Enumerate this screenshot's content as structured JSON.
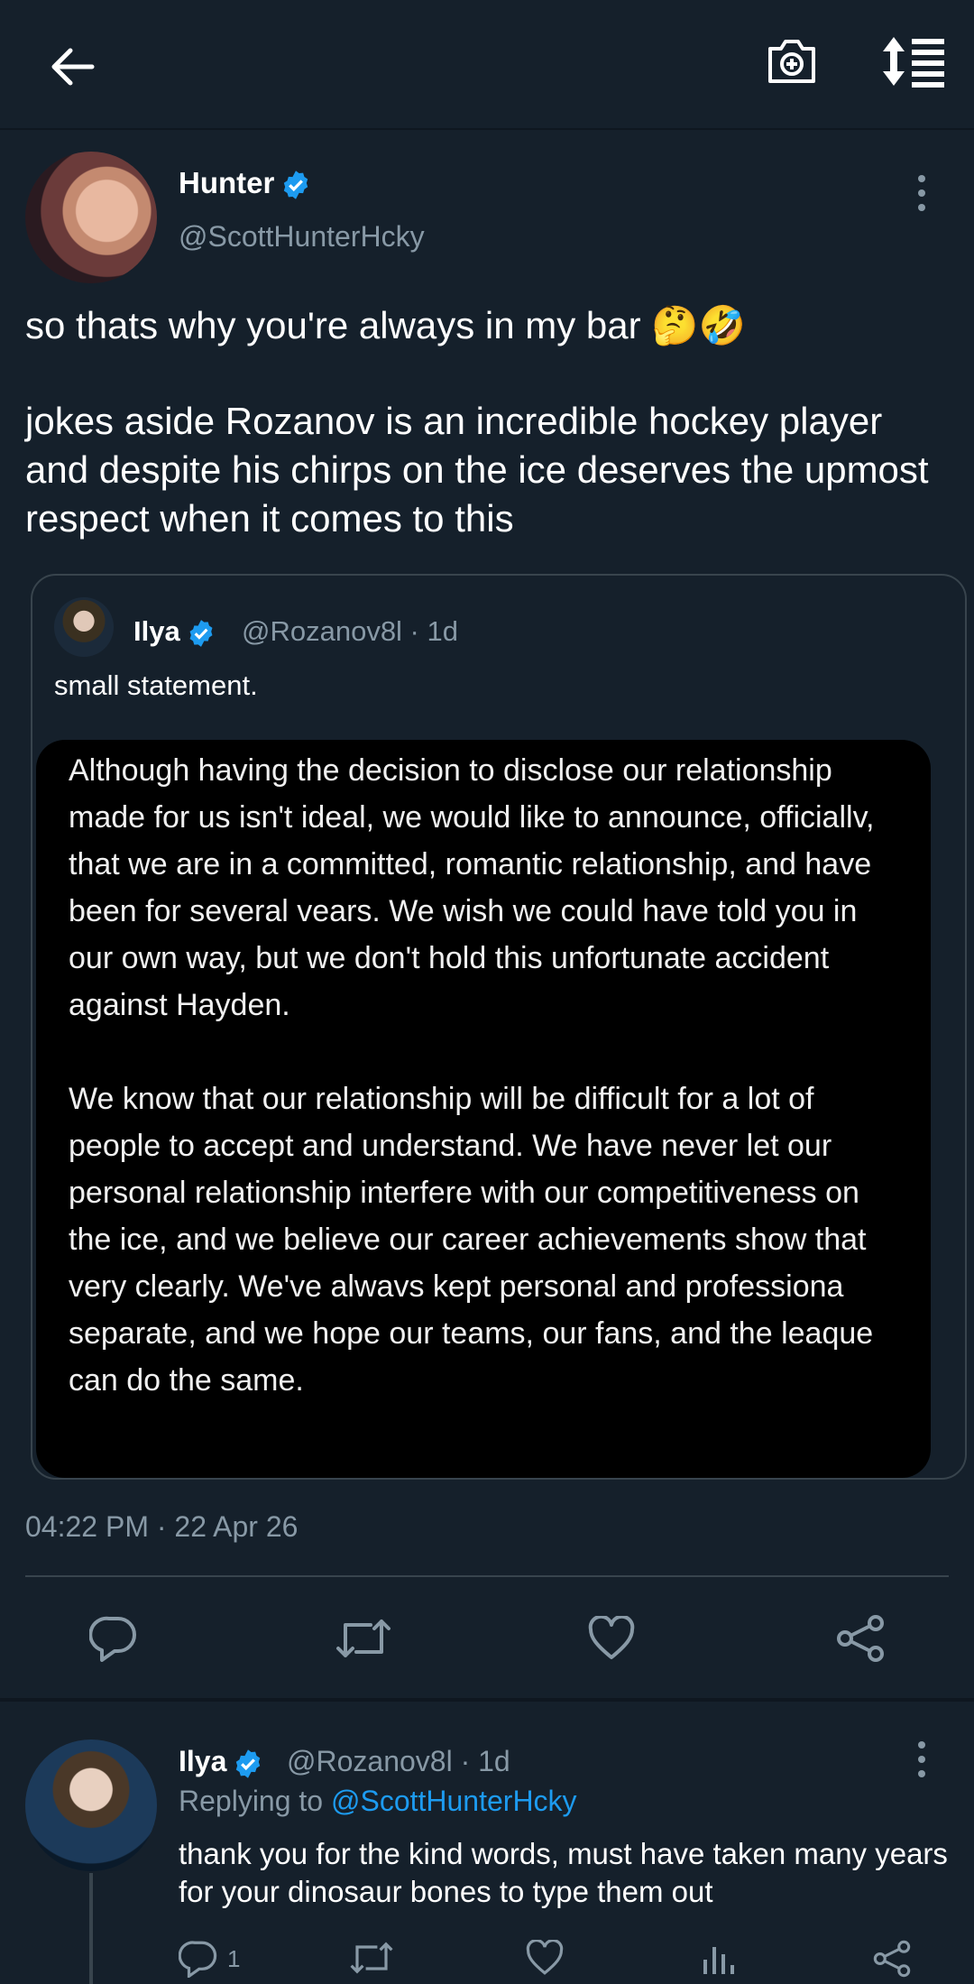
{
  "colors": {
    "background": "#15202b",
    "accent": "#1d9bf0",
    "muted": "#8899a6",
    "border": "#38444d"
  },
  "topbar": {
    "icons": [
      "back-arrow-icon",
      "camera-icon",
      "sort-icon"
    ]
  },
  "tweet": {
    "author_name": "Hunter",
    "author_handle": "@ScottHunterHcky",
    "text_line1": "so thats why you're always in my bar 🤔🤣",
    "text_body": "jokes aside Rozanov is an incredible hockey player and despite his chirps on the ice deserves the upmost respect when it comes to this",
    "timestamp": "04:22 PM · 22 Apr 26"
  },
  "quote": {
    "author_name": "Ilya",
    "author_meta": "@Rozanov8l · 1d",
    "text": "small statement.",
    "statement": "Although having the decision to disclose our relationship made for us isn't ideal, we would like to announce, officiallv, that we are in a committed, romantic relationship, and have been for several vears. We wish we could have told you in our own way, but we don't hold this unfortunate accident against Hayden.\n\nWe know that our relationship will be difficult for a lot of people to accept and understand. We have never let our personal relationship interfere with our competitiveness on the ice, and we believe our career achievements show that very clearly. We've alwavs kept personal and professiona separate, and we hope our teams, our fans, and the leaque can do the same."
  },
  "actions": [
    "reply-icon",
    "retweet-icon",
    "like-icon",
    "share-icon"
  ],
  "reply": {
    "author_name": "Ilya",
    "author_meta": "@Rozanov8l · 1d",
    "replying_prefix": "Replying to ",
    "replying_handle": "@ScottHunterHcky",
    "text": "thank you for the kind words, must have taken many years for your dinosaur bones to type them out",
    "reply_count": "1"
  }
}
